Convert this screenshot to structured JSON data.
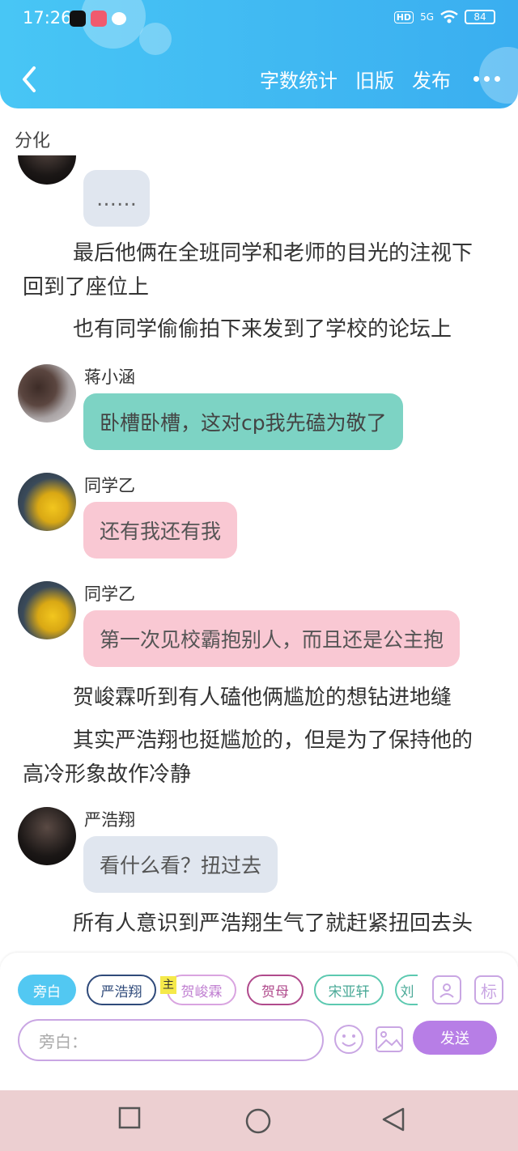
{
  "status_bar": {
    "time": "17:26",
    "hd": "HD",
    "network": "5G",
    "battery": "84"
  },
  "header": {
    "actions": [
      "字数统计",
      "旧版",
      "发布"
    ]
  },
  "chapter_title": "分化",
  "feed": [
    {
      "type": "message",
      "speaker": "",
      "avatar": "dark-avatar-icon",
      "text": "……",
      "bubble_color": "#e0e6ef",
      "text_color": "#666666"
    },
    {
      "type": "narration",
      "text": "最后他俩在全班同学和老师的目光的注视下回到了座位上"
    },
    {
      "type": "narration",
      "text": "也有同学偷偷拍下来发到了学校的论坛上"
    },
    {
      "type": "message",
      "speaker": "蒋小涵",
      "avatar": "girl-with-cat-avatar-icon",
      "text": "卧槽卧槽，这对cp我先磕为敬了",
      "bubble_color": "#7dd3c4",
      "text_color": "#444444"
    },
    {
      "type": "message",
      "speaker": "同学乙",
      "avatar": "yellow-figure-avatar-icon",
      "text": "还有我还有我",
      "bubble_color": "#f9c8d3",
      "text_color": "#555555"
    },
    {
      "type": "message",
      "speaker": "同学乙",
      "avatar": "yellow-figure-avatar-icon",
      "text": "第一次见校霸抱别人，而且还是公主抱",
      "bubble_color": "#f9c8d3",
      "text_color": "#555555"
    },
    {
      "type": "narration",
      "text": "贺峻霖听到有人磕他俩尴尬的想钻进地缝"
    },
    {
      "type": "narration",
      "text": "其实严浩翔也挺尴尬的，但是为了保持他的高冷形象故作冷静"
    },
    {
      "type": "message",
      "speaker": "严浩翔",
      "avatar": "dark-avatar-icon",
      "text": "看什么看？扭过去",
      "bubble_color": "#e0e6ef",
      "text_color": "#555555"
    },
    {
      "type": "narration",
      "text": "所有人意识到严浩翔生气了就赶紧扭回去头"
    }
  ],
  "composer": {
    "roles": [
      {
        "label": "旁白",
        "selected": true,
        "border": "#52c8f2",
        "text_color": "#ffffff"
      },
      {
        "label": "严浩翔",
        "selected": false,
        "border": "#2f4a7a",
        "text_color": "#2f4a7a"
      },
      {
        "label": "贺峻霖",
        "selected": false,
        "border": "#d9a4e0",
        "text_color": "#c07fd1"
      },
      {
        "label": "贺母",
        "selected": false,
        "border": "#b04a8c",
        "text_color": "#b04a8c"
      },
      {
        "label": "宋亚轩",
        "selected": false,
        "border": "#5cc9b0",
        "text_color": "#4aa997"
      },
      {
        "label": "刘",
        "selected": false,
        "border": "#5cc9b0",
        "text_color": "#4aa997"
      }
    ],
    "main_tag": "主",
    "mark_label": "标",
    "input_placeholder": "旁白：",
    "send_label": "发送"
  },
  "colors": {
    "header_start": "#48c6f5",
    "header_end": "#3aaef0",
    "accent_purple": "#b77ee6",
    "navbar": "#eccfd1"
  }
}
